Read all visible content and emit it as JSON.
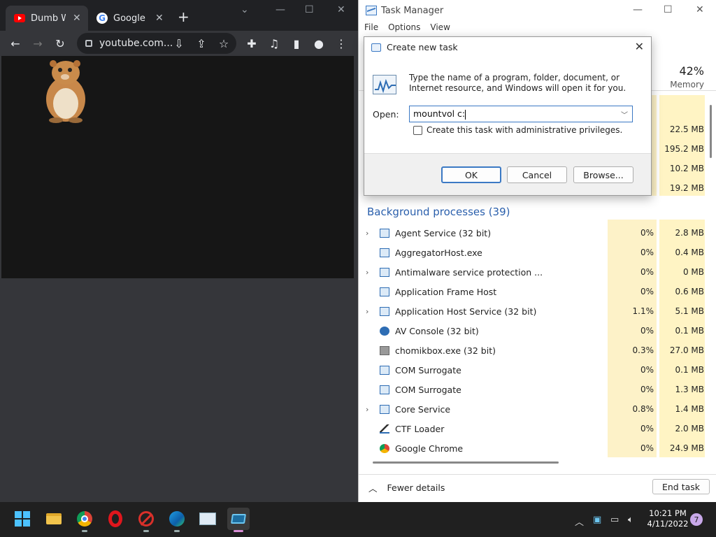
{
  "chrome": {
    "tabs": [
      {
        "title": "Dumb Ways",
        "favicon": "youtube-icon",
        "active": true
      },
      {
        "title": "Google Chrome",
        "favicon": "google-icon",
        "active": false
      }
    ],
    "new_tab": "+",
    "url": "youtube.com..."
  },
  "taskmgr": {
    "title": "Task Manager",
    "menu": [
      "File",
      "Options",
      "View"
    ],
    "memory_pct": "42%",
    "memory_label": "Memory",
    "top_mem": [
      "22.5 MB",
      "195.2 MB",
      "10.2 MB",
      "19.2 MB"
    ],
    "section_title": "Background processes (39)",
    "processes": [
      {
        "name": "Agent Service (32 bit)",
        "cpu": "0%",
        "mem": "2.8 MB",
        "expandable": true,
        "icon": "window-icon"
      },
      {
        "name": "AggregatorHost.exe",
        "cpu": "0%",
        "mem": "0.4 MB",
        "expandable": false,
        "icon": "window-icon"
      },
      {
        "name": "Antimalware service protection ...",
        "cpu": "0%",
        "mem": "0 MB",
        "expandable": true,
        "icon": "window-icon"
      },
      {
        "name": "Application Frame Host",
        "cpu": "0%",
        "mem": "0.6 MB",
        "expandable": false,
        "icon": "window-icon"
      },
      {
        "name": "Application Host Service (32 bit)",
        "cpu": "1.1%",
        "mem": "5.1 MB",
        "expandable": true,
        "icon": "window-icon"
      },
      {
        "name": "AV Console (32 bit)",
        "cpu": "0%",
        "mem": "0.1 MB",
        "expandable": false,
        "icon": "av-console-icon"
      },
      {
        "name": "chomikbox.exe (32 bit)",
        "cpu": "0.3%",
        "mem": "27.0 MB",
        "expandable": false,
        "icon": "chomikbox-icon"
      },
      {
        "name": "COM Surrogate",
        "cpu": "0%",
        "mem": "0.1 MB",
        "expandable": false,
        "icon": "window-icon"
      },
      {
        "name": "COM Surrogate",
        "cpu": "0%",
        "mem": "1.3 MB",
        "expandable": false,
        "icon": "window-icon"
      },
      {
        "name": "Core Service",
        "cpu": "0.8%",
        "mem": "1.4 MB",
        "expandable": true,
        "icon": "window-icon"
      },
      {
        "name": "CTF Loader",
        "cpu": "0%",
        "mem": "2.0 MB",
        "expandable": false,
        "icon": "pen-icon"
      },
      {
        "name": "Google Chrome",
        "cpu": "0%",
        "mem": "24.9 MB",
        "expandable": false,
        "icon": "chrome-icon"
      }
    ],
    "fewer_details": "Fewer details",
    "end_task": "End task"
  },
  "dialog": {
    "title": "Create new task",
    "message": "Type the name of a program, folder, document, or Internet resource, and Windows will open it for you.",
    "open_label": "Open:",
    "open_value": "mountvol c:",
    "admin_label": "Create this task with administrative privileges.",
    "admin_checked": false,
    "ok": "OK",
    "cancel": "Cancel",
    "browse": "Browse..."
  },
  "taskbar": {
    "apps": [
      "start-icon",
      "file-explorer-icon",
      "chrome-icon",
      "opera-icon",
      "blocked-app-icon",
      "edge-icon",
      "task-manager-icon",
      "task-manager-active-icon"
    ],
    "time": "10:21 PM",
    "date": "4/11/2022",
    "notifications": "7"
  },
  "colors": {
    "accent": "#3b79c4",
    "heat_light": "#fff4c4",
    "section_blue": "#2a5fac"
  }
}
